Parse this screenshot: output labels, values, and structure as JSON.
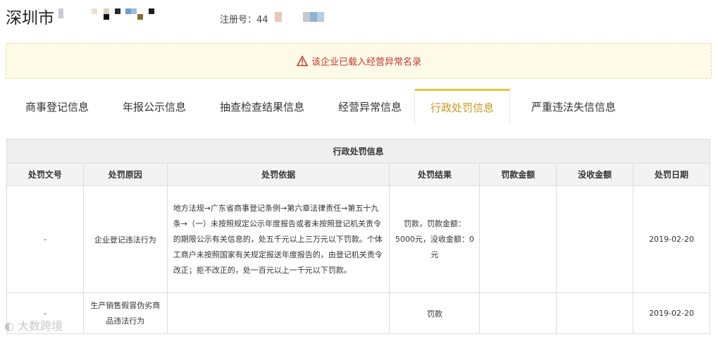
{
  "header": {
    "company_name": "深圳市",
    "registration_label": "注册号：44"
  },
  "alert": {
    "message": "该企业已载入经营异常名录",
    "icon": "warning-icon",
    "color": "#c0392b"
  },
  "tabs": [
    {
      "label": "商事登记信息",
      "active": false
    },
    {
      "label": "年报公示信息",
      "active": false
    },
    {
      "label": "抽查检查结果信息",
      "active": false
    },
    {
      "label": "经营异常信息",
      "active": false
    },
    {
      "label": "行政处罚信息",
      "active": true
    },
    {
      "label": "严重违法失信信息",
      "active": false
    }
  ],
  "accent_color": "#f0c43a",
  "table": {
    "caption": "行政处罚信息",
    "columns": [
      "处罚文号",
      "处罚原因",
      "处罚依据",
      "处罚结果",
      "罚款金额",
      "没收金额",
      "处罚日期"
    ],
    "rows": [
      {
        "doc_no": "-",
        "reason": "企业登记违法行为",
        "basis": "地方法规→广东省商事登记条例→第六章法律责任→第五十九条→（一）未按照规定公示年度报告或者未按照登记机关责令的期限公示有关信息的，处五千元以上三万元以下罚款。个体工商户未按照国家有关规定报送年度报告的，由登记机关责令改正；拒不改正的，处一百元以上一千元以下罚款。",
        "result": "罚款，罚款金额：5000元，没收金额：0元",
        "fine": "",
        "confiscated": "",
        "date": "2019-02-20"
      },
      {
        "doc_no": "-",
        "reason": "生产销售假冒伪劣商品违法行为",
        "basis": "",
        "result": "罚款",
        "fine": "",
        "confiscated": "",
        "date": "2019-02-20"
      }
    ]
  },
  "watermark": "大数跨境"
}
